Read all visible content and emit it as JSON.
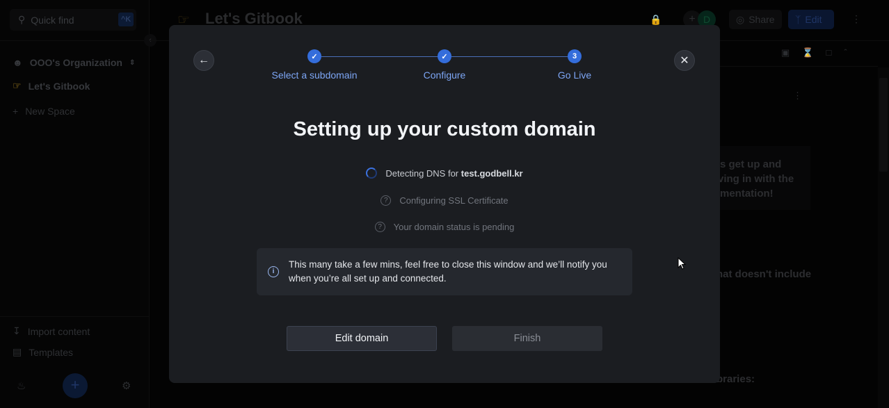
{
  "sidebar": {
    "quick_find": "Quick find",
    "shortcut": "^K",
    "org": "OOO's Organization",
    "space": "Let's Gitbook",
    "new_space": "New Space",
    "import": "Import content",
    "templates": "Templates"
  },
  "header": {
    "title": "Let's Gitbook",
    "avatar": "D",
    "share": "Share",
    "edit": "Edit"
  },
  "background_content": {
    "callout_lines": [
      "s get up and",
      "ving in with the",
      "mentation!"
    ],
    "line2": "hat doesn't include",
    "line3": "braries:"
  },
  "modal": {
    "steps": [
      {
        "label": "Select a subdomain",
        "state": "done",
        "marker": "✓"
      },
      {
        "label": "Configure",
        "state": "done",
        "marker": "✓"
      },
      {
        "label": "Go Live",
        "state": "current",
        "marker": "3"
      }
    ],
    "title": "Setting up your custom domain",
    "status": {
      "dns_prefix": "Detecting DNS for",
      "dns_domain": "test.godbell.kr",
      "ssl": "Configuring SSL Certificate",
      "domain": "Your domain status is pending"
    },
    "info": "This many take a few mins, feel free to close this window and we’ll notify you when you’re all set up and connected.",
    "edit_domain": "Edit domain",
    "finish": "Finish"
  },
  "colors": {
    "accent": "#346ddb",
    "modal_bg": "#1b1d21"
  }
}
